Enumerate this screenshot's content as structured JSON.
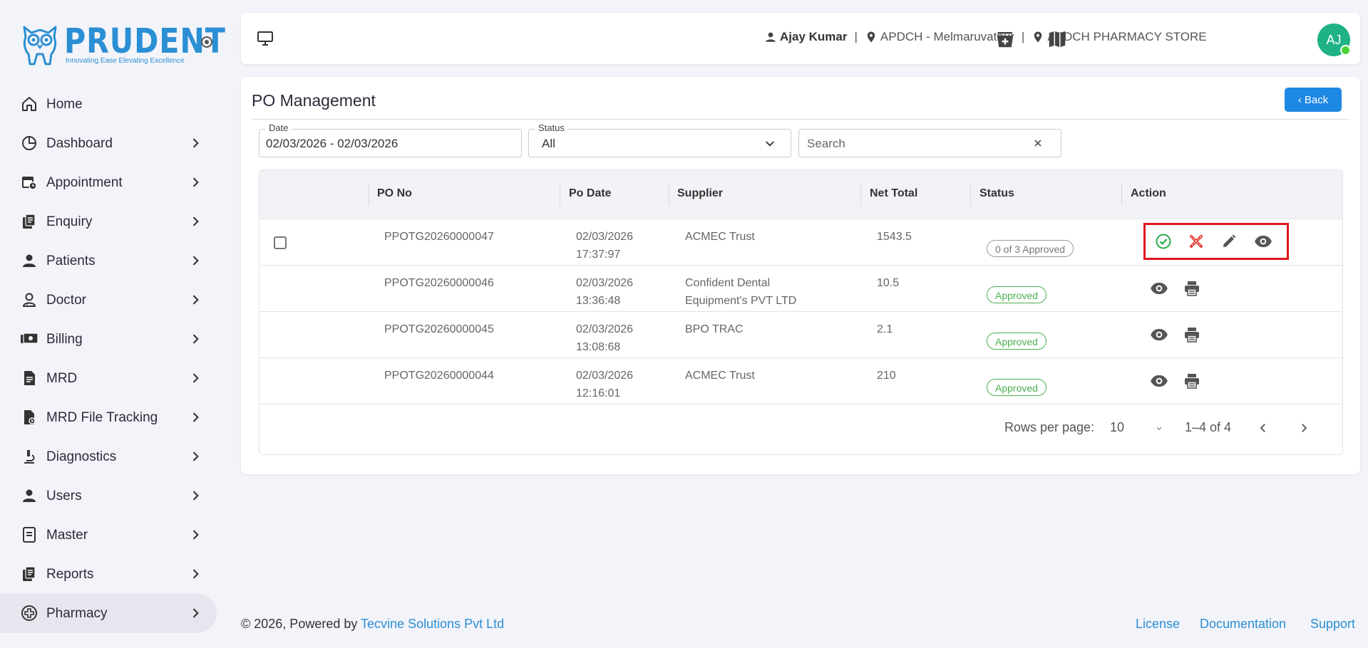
{
  "brand": {
    "name": "PRUDENT",
    "tagline": "Innovating Ease Elevating Excellence"
  },
  "colors": {
    "primary": "#1e88e5",
    "brand": "#2b8fd4",
    "approved": "#4caf50",
    "reject": "#e53935",
    "avatar": "#1fb287",
    "highlight": "#e0141e"
  },
  "sidebar": {
    "items": [
      {
        "label": "Home",
        "icon": "home-icon",
        "expandable": false
      },
      {
        "label": "Dashboard",
        "icon": "pie-chart-icon",
        "expandable": true
      },
      {
        "label": "Appointment",
        "icon": "calendar-clock-icon",
        "expandable": true
      },
      {
        "label": "Enquiry",
        "icon": "copy-doc-icon",
        "expandable": true
      },
      {
        "label": "Patients",
        "icon": "person-icon",
        "expandable": true
      },
      {
        "label": "Doctor",
        "icon": "doctor-icon",
        "expandable": true
      },
      {
        "label": "Billing",
        "icon": "money-icon",
        "expandable": true
      },
      {
        "label": "MRD",
        "icon": "document-icon",
        "expandable": true
      },
      {
        "label": "MRD File Tracking",
        "icon": "file-track-icon",
        "expandable": true
      },
      {
        "label": "Diagnostics",
        "icon": "microscope-icon",
        "expandable": true
      },
      {
        "label": "Users",
        "icon": "person-icon",
        "expandable": true
      },
      {
        "label": "Master",
        "icon": "list-box-icon",
        "expandable": true
      },
      {
        "label": "Reports",
        "icon": "report-icon",
        "expandable": true
      },
      {
        "label": "Pharmacy",
        "icon": "pharmacy-icon",
        "expandable": true,
        "active": true
      }
    ]
  },
  "topbar": {
    "user_name": "Ajay Kumar",
    "location": "APDCH - Melmaruvathur",
    "store": "APDCH PHARMACY STORE",
    "avatar_initials": "AJ"
  },
  "page": {
    "title": "PO Management",
    "back_label": "‹ Back"
  },
  "filters": {
    "date_label": "Date",
    "date_value": "02/03/2026 - 02/03/2026",
    "status_label": "Status",
    "status_value": "All",
    "search_placeholder": "Search"
  },
  "table": {
    "columns": [
      "PO No",
      "Po Date",
      "Supplier",
      "Net Total",
      "Status",
      "Action"
    ],
    "rows": [
      {
        "po_no": "PPOTG20260000047",
        "date": "02/03/2026",
        "time": "17:37:97",
        "supplier_1": "ACMEC Trust",
        "supplier_2": "",
        "net_total": "1543.5",
        "status": "0 of 3 Approved",
        "status_type": "pending",
        "actions": [
          "approve-icon",
          "reject-icon",
          "edit-icon",
          "view-icon"
        ]
      },
      {
        "po_no": "PPOTG20260000046",
        "date": "02/03/2026",
        "time": "13:36:48",
        "supplier_1": "Confident Dental",
        "supplier_2": "Equipment's PVT LTD",
        "net_total": "10.5",
        "status": "Approved",
        "status_type": "approved",
        "actions": [
          "view-icon",
          "print-icon"
        ]
      },
      {
        "po_no": "PPOTG20260000045",
        "date": "02/03/2026",
        "time": "13:08:68",
        "supplier_1": "BPO TRAC",
        "supplier_2": "",
        "net_total": "2.1",
        "status": "Approved",
        "status_type": "approved",
        "actions": [
          "view-icon",
          "print-icon"
        ]
      },
      {
        "po_no": "PPOTG20260000044",
        "date": "02/03/2026",
        "time": "12:16:01",
        "supplier_1": "ACMEC Trust",
        "supplier_2": "",
        "net_total": "210",
        "status": "Approved",
        "status_type": "approved",
        "actions": [
          "view-icon",
          "print-icon"
        ]
      }
    ]
  },
  "pagination": {
    "rows_per_page_label": "Rows per page:",
    "rows_per_page": "10",
    "range": "1–4 of 4"
  },
  "footer": {
    "copyright": "© 2026, Powered by ",
    "company": "Tecvine Solutions Pvt Ltd",
    "links": [
      "License",
      "Documentation",
      "Support"
    ]
  }
}
